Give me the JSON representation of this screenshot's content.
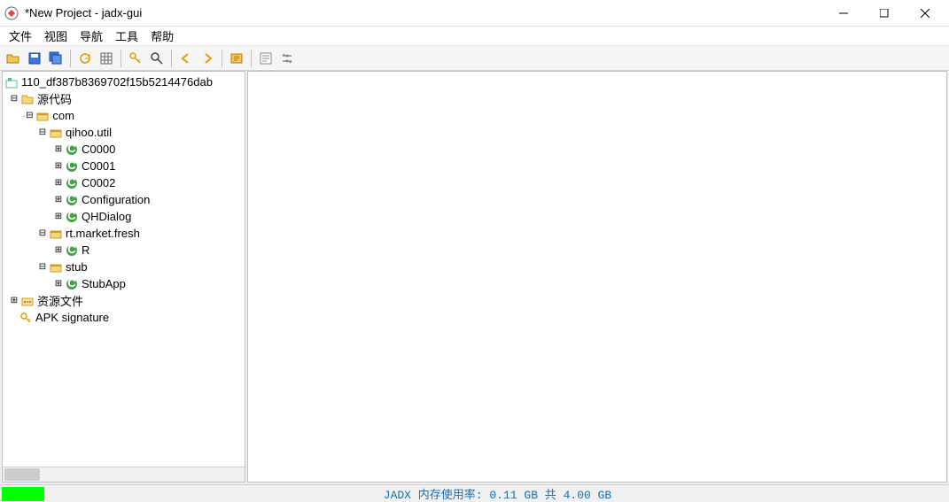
{
  "window": {
    "title": "*New Project - jadx-gui"
  },
  "menu": {
    "file": "文件",
    "view": "视图",
    "nav": "导航",
    "tools": "工具",
    "help": "帮助"
  },
  "toolbar_icons": {
    "open": "open-folder-icon",
    "save": "save-icon",
    "saveall": "save-all-icon",
    "sync": "sync-icon",
    "grid": "grid-icon",
    "key": "key-icon",
    "search": "search-icon",
    "back": "back-arrow-icon",
    "forward": "forward-arrow-icon",
    "refresh": "refresh-icon",
    "log": "log-icon",
    "settings": "settings-icon"
  },
  "tree": {
    "root": "110_df387b8369702f15b5214476dab",
    "source": "源代码",
    "com": "com",
    "qihoo": "qihoo.util",
    "c0000": "C0000",
    "c0001": "C0001",
    "c0002": "C0002",
    "configuration": "Configuration",
    "qhdialog": "QHDialog",
    "rtmarket": "rt.market.fresh",
    "r": "R",
    "stub": "stub",
    "stubapp": "StubApp",
    "resources": "资源文件",
    "apksig": "APK signature"
  },
  "status": {
    "memory": "JADX 内存使用率: 0.11 GB 共 4.00 GB"
  }
}
